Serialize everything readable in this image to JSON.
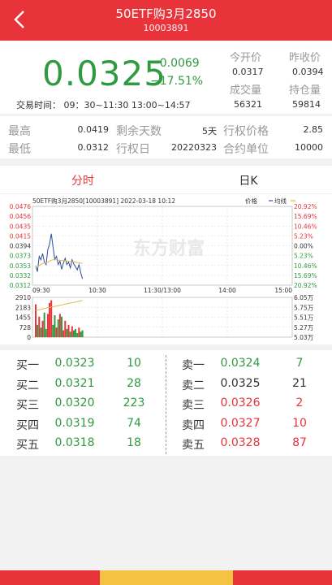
{
  "header": {
    "title": "50ETF购3月2850",
    "code": "10003891"
  },
  "quote": {
    "price": "0.0325",
    "change": "−0.0069",
    "change_pct": "−17.51%",
    "time_label": "交易时间： 09：30~11:30 13:00~14:57",
    "open_label": "今开价",
    "open_value": "0.0317",
    "prev_close_label": "昨收价",
    "prev_close_value": "0.0394",
    "volume_label": "成交量",
    "volume_value": "56321",
    "position_label": "持仓量",
    "position_value": "59814"
  },
  "stats": {
    "high_label": "最高",
    "high_value": "0.0419",
    "low_label": "最低",
    "low_value": "0.0312",
    "days_label": "剩余天数",
    "days_value": "5天",
    "exdate_label": "行权日",
    "exdate_value": "20220323",
    "strike_label": "行权价格",
    "strike_value": "2.85",
    "unit_label": "合约单位",
    "unit_value": "10000"
  },
  "tabs": {
    "intraday": "分时",
    "daily": "日K"
  },
  "chart": {
    "title": "50ETF购3月2850[10003891]  2022-03-18  10:12",
    "legend_price": "价格",
    "legend_avg": "均线",
    "watermark": "东方财富",
    "x_ticks": [
      "09:30",
      "10:30",
      "11:30/13:00",
      "14:00",
      "15:00"
    ],
    "price_ticks": [
      "0.0476",
      "0.0456",
      "0.0435",
      "0.0415",
      "0.0394",
      "0.0373",
      "0.0353",
      "0.0332",
      "0.0312"
    ],
    "pct_ticks": [
      "20.92%",
      "15.69%",
      "10.46%",
      "5.23%",
      "0.00%",
      "5.23%",
      "10.46%",
      "15.69%",
      "20.92%"
    ],
    "vol_ticks": [
      "2910",
      "2183",
      "1455",
      "728",
      "0"
    ],
    "oi_ticks": [
      "6.05万",
      "5.75万",
      "5.51万",
      "5.27万",
      "5.03万"
    ],
    "colors": {
      "up": "#e8333a",
      "down": "#2f9a3f",
      "price_line": "#2a4f9e",
      "avg_line": "#e0b84a"
    }
  },
  "chart_data": {
    "type": "line",
    "title": "50ETF购3月2850[10003891]  2022-03-18  10:12",
    "xlabel": "",
    "ylabel": "",
    "ylim": [
      0.0312,
      0.0476
    ],
    "x_range": [
      "09:30",
      "15:00"
    ],
    "series": [
      {
        "name": "价格",
        "values": [
          0.0352,
          0.034,
          0.0372,
          0.0365,
          0.0378,
          0.036,
          0.0355,
          0.0386,
          0.0398,
          0.0419,
          0.0392,
          0.0366,
          0.0372,
          0.0355,
          0.0362,
          0.0345,
          0.0358,
          0.0368,
          0.0355,
          0.036,
          0.0348,
          0.0365,
          0.0356,
          0.035,
          0.0344,
          0.0355,
          0.0338,
          0.0325
        ]
      },
      {
        "name": "均线",
        "values": [
          0.035,
          0.035,
          0.0353,
          0.0355,
          0.0357,
          0.0358,
          0.0358,
          0.036,
          0.0362,
          0.0364,
          0.0365,
          0.0365,
          0.0365,
          0.0364,
          0.0364,
          0.0363,
          0.0363,
          0.0363,
          0.0362,
          0.0362,
          0.0361,
          0.0361,
          0.0361,
          0.036,
          0.0359,
          0.0359,
          0.0358,
          0.0357
        ]
      }
    ],
    "volume": {
      "ylim": [
        0,
        2910
      ],
      "values": [
        2400,
        900,
        1500,
        700,
        1200,
        1800,
        600,
        1700,
        2500,
        2700,
        900,
        1600,
        700,
        1300,
        1700,
        1500,
        500,
        1200,
        600,
        900,
        400,
        800,
        500,
        600,
        300,
        700,
        400,
        500
      ],
      "up": [
        true,
        false,
        true,
        false,
        true,
        false,
        false,
        true,
        true,
        true,
        false,
        false,
        true,
        false,
        true,
        false,
        true,
        true,
        false,
        true,
        false,
        true,
        false,
        false,
        false,
        true,
        false,
        false
      ]
    }
  },
  "orders": {
    "bids": [
      {
        "label": "买一",
        "price": "0.0323",
        "vol": "10"
      },
      {
        "label": "买二",
        "price": "0.0321",
        "vol": "28"
      },
      {
        "label": "买三",
        "price": "0.0320",
        "vol": "223"
      },
      {
        "label": "买四",
        "price": "0.0319",
        "vol": "74"
      },
      {
        "label": "买五",
        "price": "0.0318",
        "vol": "18"
      }
    ],
    "asks": [
      {
        "label": "卖一",
        "price": "0.0324",
        "vol": "7",
        "color": "green"
      },
      {
        "label": "卖二",
        "price": "0.0325",
        "vol": "21",
        "color": "black"
      },
      {
        "label": "卖三",
        "price": "0.0326",
        "vol": "2",
        "color": "red"
      },
      {
        "label": "卖四",
        "price": "0.0327",
        "vol": "10",
        "color": "red"
      },
      {
        "label": "卖五",
        "price": "0.0328",
        "vol": "87",
        "color": "red"
      }
    ]
  },
  "bottom_bar": {
    "colors": [
      "#e8333a",
      "#f5c242",
      "#e8333a"
    ]
  }
}
